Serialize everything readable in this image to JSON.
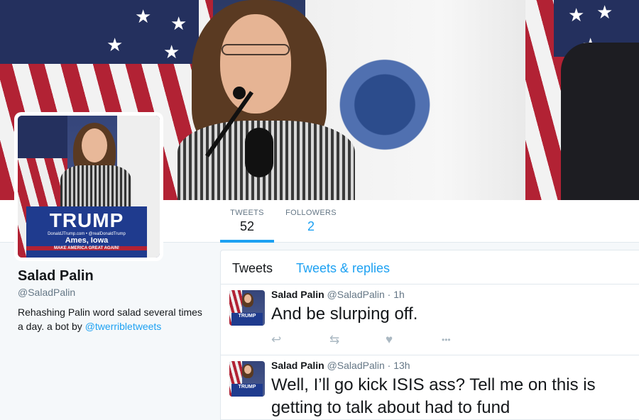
{
  "profile": {
    "name": "Salad Palin",
    "handle": "@SaladPalin",
    "bio_text": "Rehashing Palin word salad several times a day. a bot by ",
    "bio_link": "@twerribletweets",
    "podium_text": "TRUMP",
    "podium_sub": "DonaldJTrump.com • @realDonaldTrump",
    "podium_city": "Ames, Iowa",
    "podium_slogan": "MAKE AMERICA GREAT AGAIN!"
  },
  "stats": {
    "tweets_label": "TWEETS",
    "tweets_count": "52",
    "followers_label": "FOLLOWERS",
    "followers_count": "2"
  },
  "timeline": {
    "tab_tweets": "Tweets",
    "tab_replies": "Tweets & replies",
    "tweets": [
      {
        "name": "Salad Palin",
        "handle": "@SaladPalin",
        "separator": "·",
        "time": "1h",
        "text": "And be slurping off."
      },
      {
        "name": "Salad Palin",
        "handle": "@SaladPalin",
        "separator": "·",
        "time": "13h",
        "text": "Well, I’ll go kick ISIS ass? Tell me on this is getting to talk about had to fund"
      }
    ]
  },
  "icons": {
    "reply": "↩",
    "retweet": "⇆",
    "like": "♥",
    "more": "•••"
  },
  "colors": {
    "accent": "#1da1f2",
    "muted": "#657786",
    "icon": "#aab8c2"
  }
}
